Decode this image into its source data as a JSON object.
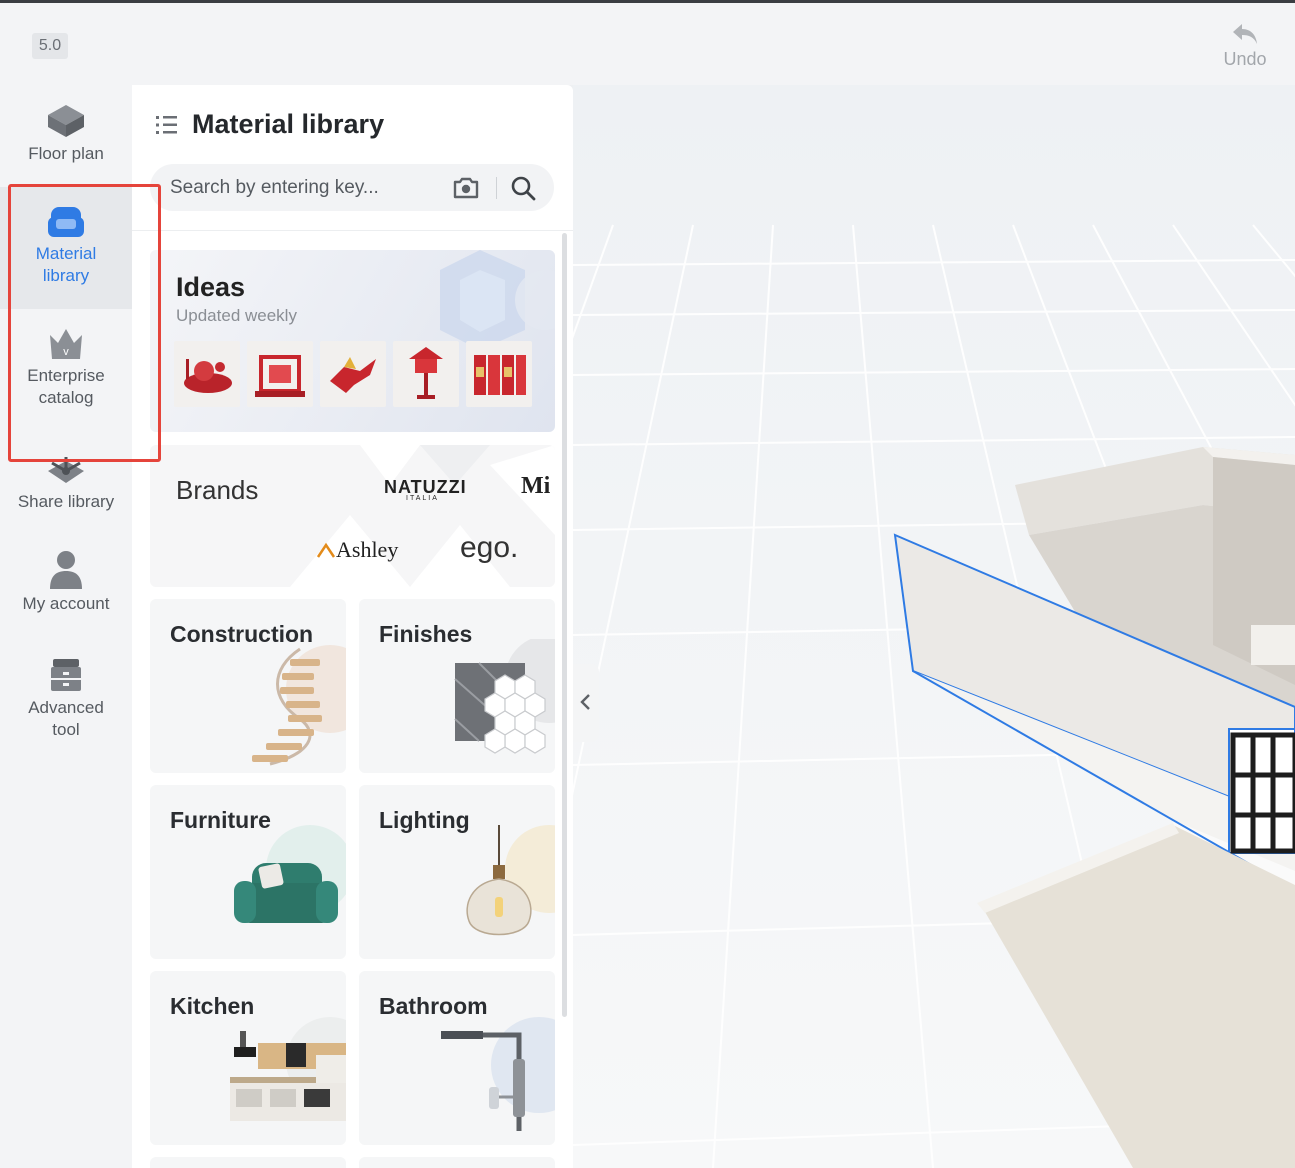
{
  "app": {
    "version": "5.0",
    "undo_label": "Undo"
  },
  "nav": {
    "items": [
      {
        "label": "Floor plan"
      },
      {
        "label": "Material library"
      },
      {
        "label": "Enterprise catalog"
      },
      {
        "label": "Share library"
      },
      {
        "label": "My account"
      },
      {
        "label": "Advanced tool"
      }
    ],
    "active": "Material library"
  },
  "panel": {
    "title": "Material library",
    "search_placeholder": "Search by entering key...",
    "ideas": {
      "title": "Ideas",
      "subtitle": "Updated weekly"
    },
    "brands": {
      "title": "Brands",
      "logos": [
        "NATUZZI",
        "ITALIA",
        "Mi",
        "Ashley",
        "ego."
      ]
    },
    "categories": [
      {
        "label": "Construction"
      },
      {
        "label": "Finishes"
      },
      {
        "label": "Furniture"
      },
      {
        "label": "Lighting"
      },
      {
        "label": "Kitchen"
      },
      {
        "label": "Bathroom"
      }
    ]
  },
  "colors": {
    "accent": "#2f7be4",
    "highlight_box": "#e5443b",
    "wall_outline": "#2f7be4"
  },
  "icons": [
    "floor-plan-icon",
    "sofa-icon",
    "crown-icon",
    "share-icon",
    "user-icon",
    "toolbox-icon",
    "undo-icon",
    "camera-icon",
    "search-icon",
    "list-icon",
    "chevron-left-icon"
  ]
}
